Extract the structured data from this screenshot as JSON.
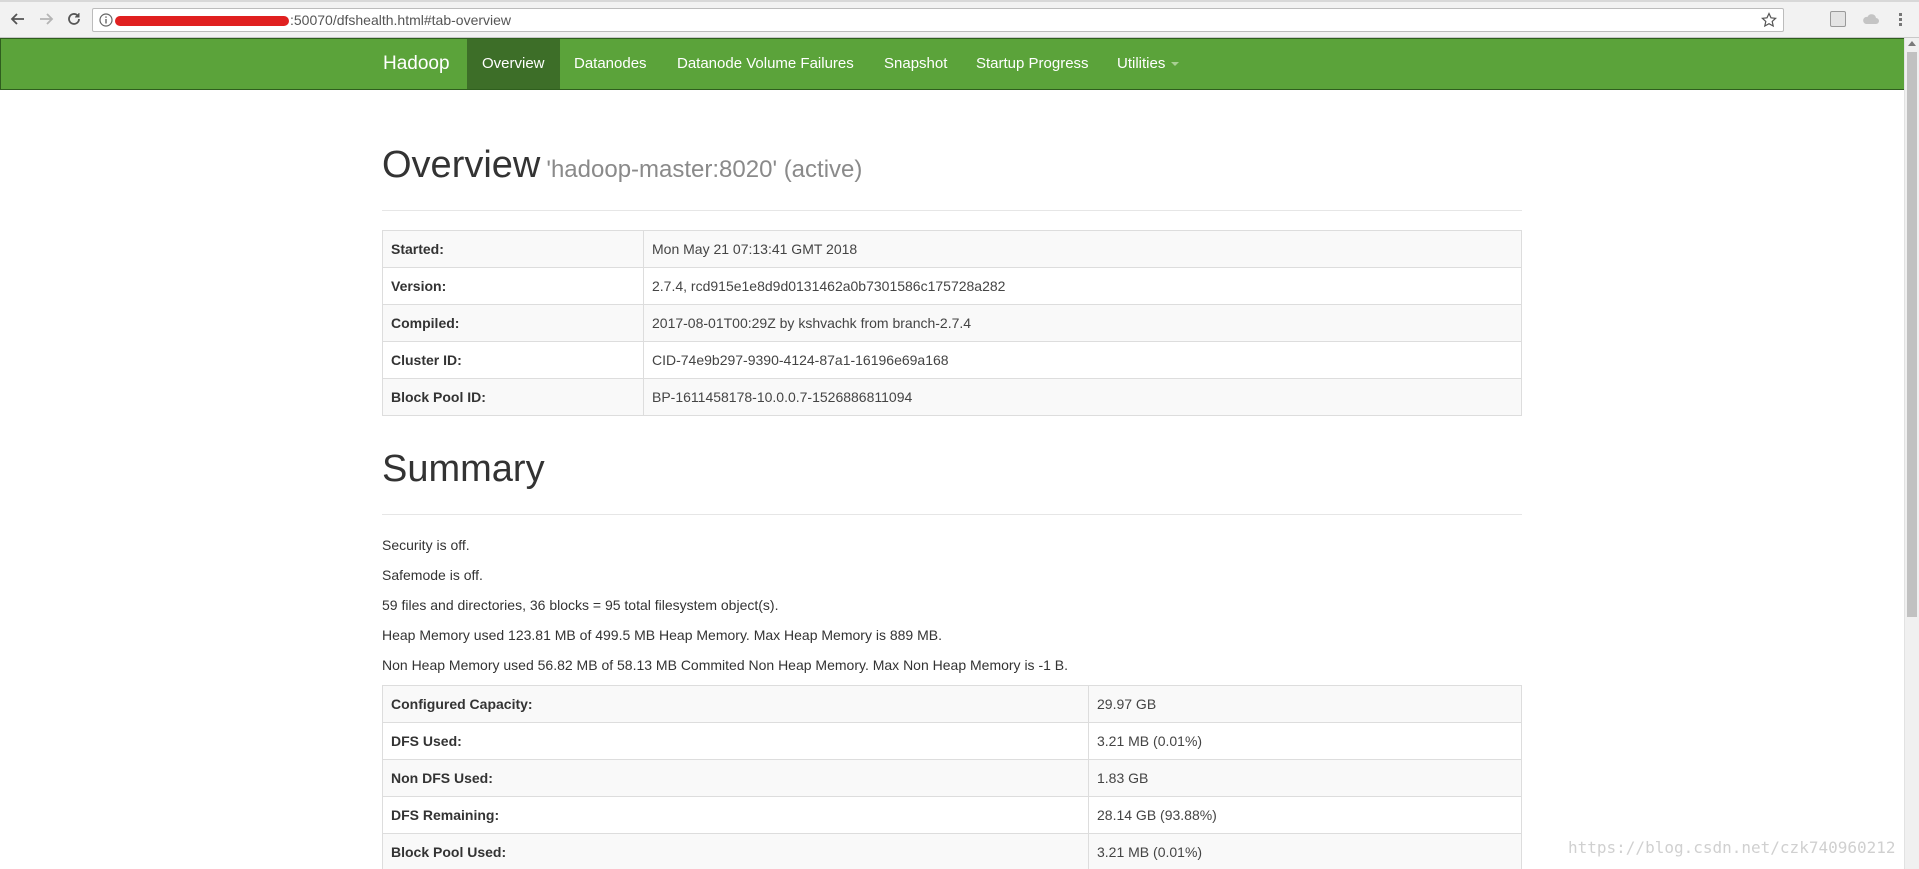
{
  "browser": {
    "url_visible": ":50070/dfshealth.html#tab-overview"
  },
  "navbar": {
    "brand": "Hadoop",
    "items": [
      {
        "label": "Overview"
      },
      {
        "label": "Datanodes"
      },
      {
        "label": "Datanode Volume Failures"
      },
      {
        "label": "Snapshot"
      },
      {
        "label": "Startup Progress"
      },
      {
        "label": "Utilities"
      }
    ],
    "active_index": 0
  },
  "overview": {
    "title": "Overview",
    "subtitle": "'hadoop-master:8020' (active)",
    "rows": [
      {
        "key": "Started:",
        "value": "Mon May 21 07:13:41 GMT 2018"
      },
      {
        "key": "Version:",
        "value": "2.7.4, rcd915e1e8d9d0131462a0b7301586c175728a282"
      },
      {
        "key": "Compiled:",
        "value": "2017-08-01T00:29Z by kshvachk from branch-2.7.4"
      },
      {
        "key": "Cluster ID:",
        "value": "CID-74e9b297-9390-4124-87a1-16196e69a168"
      },
      {
        "key": "Block Pool ID:",
        "value": "BP-1611458178-10.0.0.7-1526886811094"
      }
    ]
  },
  "summary": {
    "title": "Summary",
    "lines": [
      "Security is off.",
      "Safemode is off.",
      "59 files and directories, 36 blocks = 95 total filesystem object(s).",
      "Heap Memory used 123.81 MB of 499.5 MB Heap Memory. Max Heap Memory is 889 MB.",
      "Non Heap Memory used 56.82 MB of 58.13 MB Commited Non Heap Memory. Max Non Heap Memory is -1 B."
    ],
    "rows": [
      {
        "key": "Configured Capacity:",
        "value": "29.97 GB"
      },
      {
        "key": "DFS Used:",
        "value": "3.21 MB (0.01%)"
      },
      {
        "key": "Non DFS Used:",
        "value": "1.83 GB"
      },
      {
        "key": "DFS Remaining:",
        "value": "28.14 GB (93.88%)"
      },
      {
        "key": "Block Pool Used:",
        "value": "3.21 MB (0.01%)"
      }
    ]
  },
  "watermark": "https://blog.csdn.net/czk740960212",
  "colors": {
    "navbar": "#5ba33a",
    "navbar_active": "#3d6e28"
  },
  "icons": [
    "back-arrow-icon",
    "forward-arrow-icon",
    "reload-icon",
    "info-icon",
    "star-icon",
    "extension-icon",
    "cloud-icon"
  ]
}
